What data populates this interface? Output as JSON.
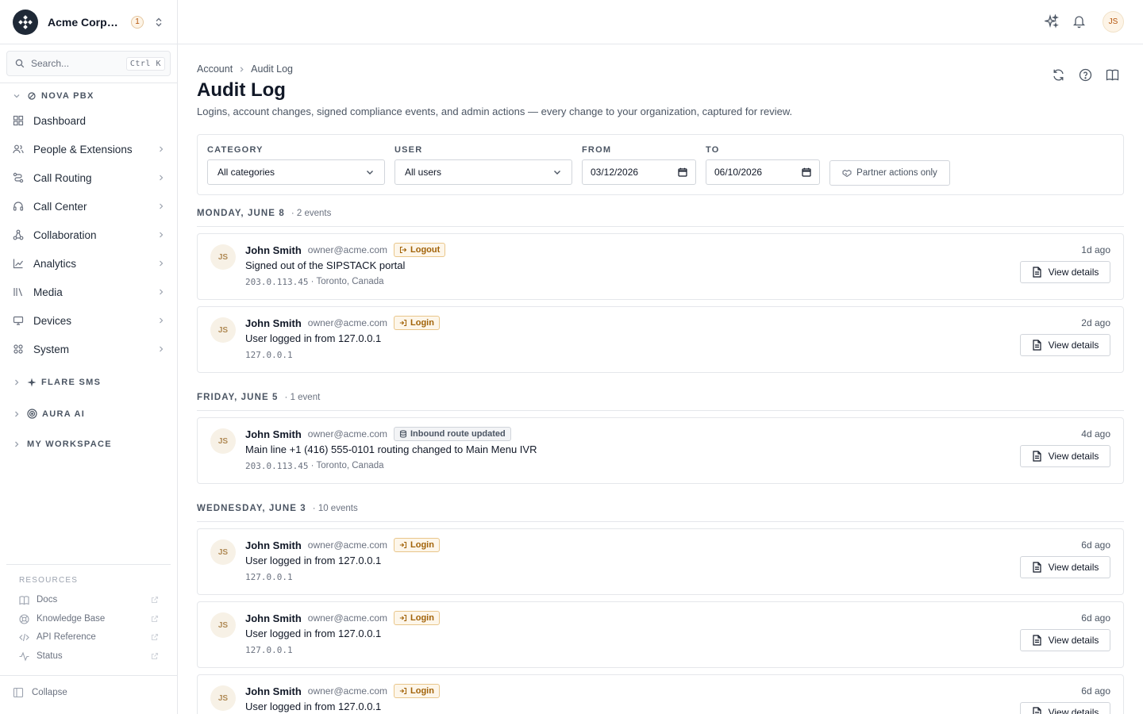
{
  "org": {
    "name": "Acme Corporation",
    "badge": "1"
  },
  "search": {
    "placeholder": "Search...",
    "shortcut": "Ctrl K"
  },
  "sections": [
    {
      "label": "NOVA PBX"
    },
    {
      "label": "FLARE SMS"
    },
    {
      "label": "AURA AI"
    },
    {
      "label": "MY WORKSPACE"
    }
  ],
  "nav": [
    {
      "label": "Dashboard"
    },
    {
      "label": "People & Extensions"
    },
    {
      "label": "Call Routing"
    },
    {
      "label": "Call Center"
    },
    {
      "label": "Collaboration"
    },
    {
      "label": "Analytics"
    },
    {
      "label": "Media"
    },
    {
      "label": "Devices"
    },
    {
      "label": "System"
    }
  ],
  "resources": {
    "title": "RESOURCES",
    "items": [
      {
        "label": "Docs"
      },
      {
        "label": "Knowledge Base"
      },
      {
        "label": "API Reference"
      },
      {
        "label": "Status"
      }
    ]
  },
  "collapse_label": "Collapse",
  "topbar": {
    "avatar": "JS"
  },
  "breadcrumb": {
    "root": "Account",
    "current": "Audit Log"
  },
  "page": {
    "title": "Audit Log",
    "subtitle": "Logins, account changes, signed compliance events, and admin actions — every change to your organization, captured for review."
  },
  "filters": {
    "category_label": "CATEGORY",
    "category_value": "All categories",
    "user_label": "USER",
    "user_value": "All users",
    "from_label": "FROM",
    "from_value": "03/12/2026",
    "to_label": "TO",
    "to_value": "06/10/2026",
    "partner_label": "Partner actions only"
  },
  "days": [
    {
      "label": "MONDAY, JUNE 8",
      "count": "· 2 events"
    },
    {
      "label": "FRIDAY, JUNE 5",
      "count": "· 1 event"
    },
    {
      "label": "WEDNESDAY, JUNE 3",
      "count": "· 10 events"
    }
  ],
  "events": [
    {
      "initials": "JS",
      "user": "John Smith",
      "email": "owner@acme.com",
      "badge": "Logout",
      "action": "Signed out of the SIPSTACK portal",
      "ip": "203.0.113.45",
      "location": " · Toronto, Canada",
      "time": "1d ago",
      "button": "View details"
    },
    {
      "initials": "JS",
      "user": "John Smith",
      "email": "owner@acme.com",
      "badge": "Login",
      "action": "User logged in from 127.0.0.1",
      "ip": "127.0.0.1",
      "location": "",
      "time": "2d ago",
      "button": "View details"
    },
    {
      "initials": "JS",
      "user": "John Smith",
      "email": "owner@acme.com",
      "badge": "Inbound route updated",
      "action": "Main line +1 (416) 555-0101 routing changed to Main Menu IVR",
      "ip": "203.0.113.45",
      "location": " · Toronto, Canada",
      "time": "4d ago",
      "button": "View details"
    },
    {
      "initials": "JS",
      "user": "John Smith",
      "email": "owner@acme.com",
      "badge": "Login",
      "action": "User logged in from 127.0.0.1",
      "ip": "127.0.0.1",
      "location": "",
      "time": "6d ago",
      "button": "View details"
    },
    {
      "initials": "JS",
      "user": "John Smith",
      "email": "owner@acme.com",
      "badge": "Login",
      "action": "User logged in from 127.0.0.1",
      "ip": "127.0.0.1",
      "location": "",
      "time": "6d ago",
      "button": "View details"
    },
    {
      "initials": "JS",
      "user": "John Smith",
      "email": "owner@acme.com",
      "badge": "Login",
      "action": "User logged in from 127.0.0.1",
      "ip": "",
      "location": "",
      "time": "6d ago",
      "button": "View details"
    }
  ]
}
